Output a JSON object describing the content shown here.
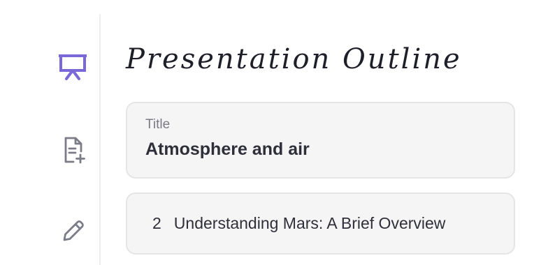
{
  "sidebar": {
    "accent_color": "#7b68d8",
    "icon_color": "#7c7c88",
    "items": [
      {
        "icon": "presentation-icon",
        "active": true
      },
      {
        "icon": "add-document-icon",
        "active": false
      },
      {
        "icon": "pencil-icon",
        "active": false
      }
    ]
  },
  "main": {
    "heading": "Presentation Outline",
    "title_field": {
      "label": "Title",
      "value": "Atmosphere and air"
    },
    "slides": [
      {
        "number": "2",
        "title": "Understanding Mars: A Brief Overview"
      }
    ]
  }
}
